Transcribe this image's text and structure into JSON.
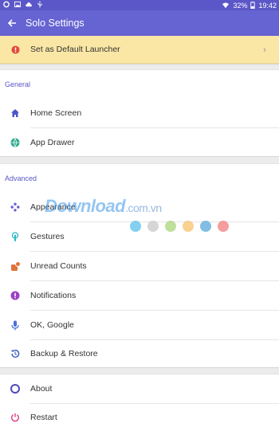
{
  "status": {
    "battery": "32%",
    "time": "19:42"
  },
  "appbar": {
    "title": "Solo Settings"
  },
  "banner": {
    "label": "Set as Default Launcher"
  },
  "general": {
    "header": "General",
    "items": [
      {
        "label": "Home Screen",
        "icon": "home-icon"
      },
      {
        "label": "App Drawer",
        "icon": "globe-icon"
      }
    ]
  },
  "advanced": {
    "header": "Advanced",
    "items": [
      {
        "label": "Appearance",
        "icon": "appearance-icon"
      },
      {
        "label": "Gestures",
        "icon": "gesture-icon"
      },
      {
        "label": "Unread Counts",
        "icon": "unread-icon"
      },
      {
        "label": "Notifications",
        "icon": "notification-icon"
      },
      {
        "label": "OK, Google",
        "icon": "microphone-icon"
      },
      {
        "label": "Backup & Restore",
        "icon": "backup-icon"
      }
    ]
  },
  "more": {
    "items": [
      {
        "label": "About",
        "icon": "about-icon"
      },
      {
        "label": "Restart",
        "icon": "power-icon"
      }
    ]
  },
  "watermark": {
    "brand": "Download",
    "suffix": ".com.vn"
  },
  "colors": {
    "appbar": "#6663d2",
    "banner": "#fae7a5",
    "accent": "#5b57c8",
    "dots": [
      "#5bc0eb",
      "#c8c8c8",
      "#a8d67a",
      "#f7c26b",
      "#5aa7d9",
      "#f27d7d"
    ]
  }
}
